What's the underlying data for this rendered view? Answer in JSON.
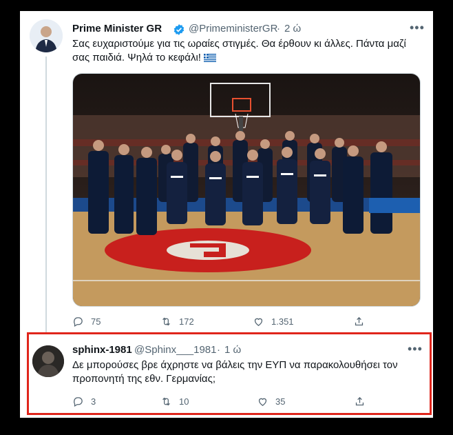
{
  "tweet1": {
    "name": "Prime Minister GR",
    "handle": "@PrimeministerGR",
    "sep": "·",
    "time": "2 ώ",
    "more": "•••",
    "text_line1": "Σας ευχαριστούμε για τις ωραίες στιγμές. Θα έρθουν κι άλλες. Πάντα μαζί",
    "text_line2": "σας παιδιά. Ψηλά το κεφάλι!",
    "replies": "75",
    "retweets": "172",
    "likes": "1.351",
    "verified_color": "#1d9bf0",
    "flag_colors": [
      "#0d5eaf",
      "#ffffff"
    ]
  },
  "tweet2": {
    "name": "sphinx-1981",
    "handle": "@Sphinx___1981",
    "sep": "·",
    "time": "1 ώ",
    "more": "•••",
    "text_line1": "Δε μπορούσες βρε άχρηστε  να βάλεις την ΕΥΠ να παρακολουθήσει τον",
    "text_line2": "προπονητή της εθν. Γερμανίας;",
    "replies": "3",
    "retweets": "10",
    "likes": "35",
    "highlight_color": "#e0251b"
  },
  "colors": {
    "text": "#0f1419",
    "muted": "#536471",
    "court": "#c49a5e",
    "court_red": "#c8201d"
  },
  "icons": [
    "verified-icon",
    "greek-flag-icon",
    "reply-icon",
    "retweet-icon",
    "like-icon",
    "share-icon",
    "more-icon"
  ]
}
